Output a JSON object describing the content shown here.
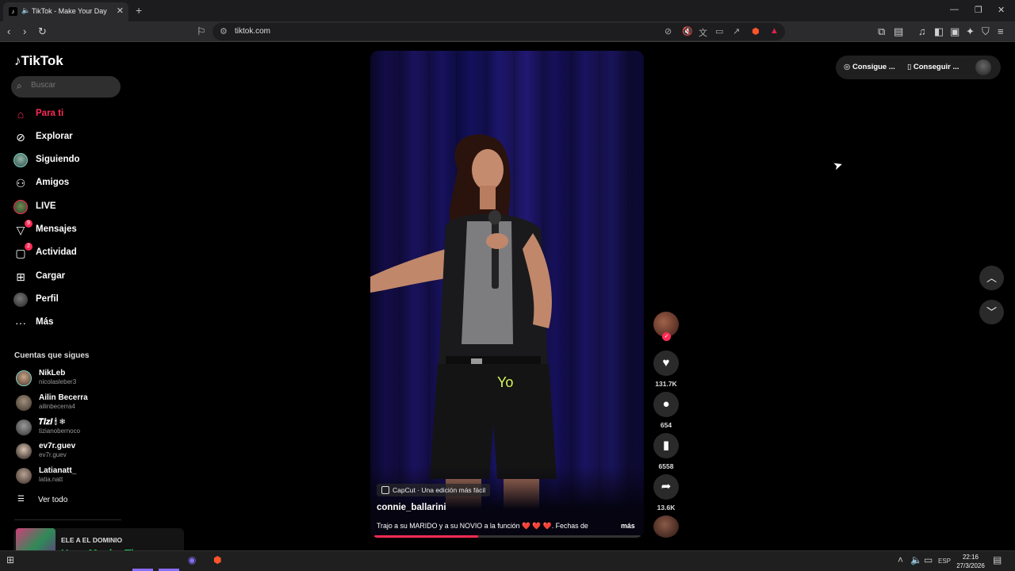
{
  "browser": {
    "tab_title": "TikTok - Make Your Day",
    "url": "tiktok.com"
  },
  "sidebar": {
    "logo": "TikTok",
    "search_placeholder": "Buscar",
    "nav": [
      {
        "label": "Para ti"
      },
      {
        "label": "Explorar"
      },
      {
        "label": "Siguiendo"
      },
      {
        "label": "Amigos"
      },
      {
        "label": "LIVE"
      },
      {
        "label": "Mensajes",
        "badge": "9"
      },
      {
        "label": "Actividad",
        "badge": "2"
      },
      {
        "label": "Cargar"
      },
      {
        "label": "Perfil"
      },
      {
        "label": "Más"
      }
    ],
    "following_title": "Cuentas que sigues",
    "accounts": [
      {
        "name": "NikLeb",
        "handle": "nicolasleber3"
      },
      {
        "name": "Ailin Becerra",
        "handle": "ailinbecerra4"
      },
      {
        "name": "𝑻𝒊𝒛𝒊 🕯 ❄",
        "handle": "tizianobernoco"
      },
      {
        "name": "ev7r.guev",
        "handle": "ev7r.guev"
      },
      {
        "name": "Latianatt_",
        "handle": "latia.natt"
      }
    ],
    "see_all": "Ver todo"
  },
  "video": {
    "caption_overlay": "Yo",
    "capcut_label": "CapCut · Una edición más fácil",
    "username": "connie_ballarini",
    "description": "Trajo a su MARIDO y a su NOVIO a la función ",
    "description_hearts": "❤️ ❤️ ❤️",
    "description_tail": ".  Fechas de",
    "more": "más",
    "progress_fraction": 0.39
  },
  "actions": {
    "likes": "131.7K",
    "comments": "654",
    "saves": "6558",
    "shares": "13.6K"
  },
  "topright": {
    "get_coins": "Consigue ...",
    "get_app": "Conseguir ..."
  },
  "mini_player": {
    "artist": "ELE A EL DOMINIO",
    "title": "Hace Mucho Tiempo"
  },
  "taskbar": {
    "lang": "ESP",
    "time": "22:16",
    "date": "27/3/2026"
  },
  "colors": {
    "accent": "#fe2c55",
    "caption": "#d6f55c",
    "mini_title": "#1ed760"
  }
}
